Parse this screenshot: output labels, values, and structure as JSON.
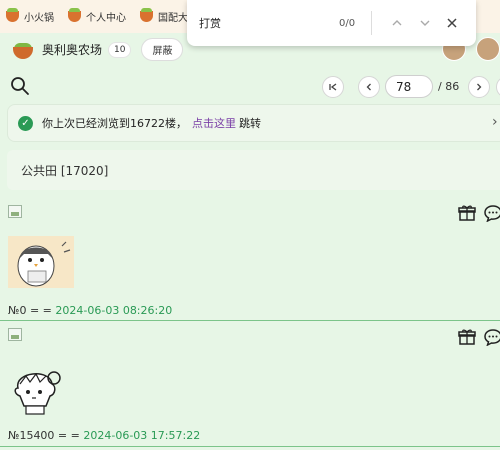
{
  "topnav": {
    "items": [
      "小火锅",
      "个人中心",
      "国配大赛"
    ]
  },
  "findbar": {
    "query": "打赏",
    "count": "0/0",
    "prev_icon": "chevron-up-icon",
    "next_icon": "chevron-down-icon",
    "close_icon": "close-icon"
  },
  "forum": {
    "title": "奥利奥农场",
    "badge": "10",
    "shield_label": "屏蔽"
  },
  "pager": {
    "current": "78",
    "total": "/ 86"
  },
  "notice": {
    "prefix": "你上次已经浏览到16722楼，",
    "link": "点击这里",
    "suffix": "跳转"
  },
  "section": {
    "title": "公共田 [17020]"
  },
  "posts": [
    {
      "floor": "№0",
      "sep": " = = ",
      "date": "2024-06-03 08:26:20"
    },
    {
      "floor": "№15400",
      "sep": " = = ",
      "date": "2024-06-03 17:57:22"
    }
  ],
  "colors": {
    "accent_green": "#2a9a55",
    "link_purple": "#7a3fa6",
    "page_bg": "#e7f6e6",
    "nav_bg": "#fbf3e7"
  }
}
